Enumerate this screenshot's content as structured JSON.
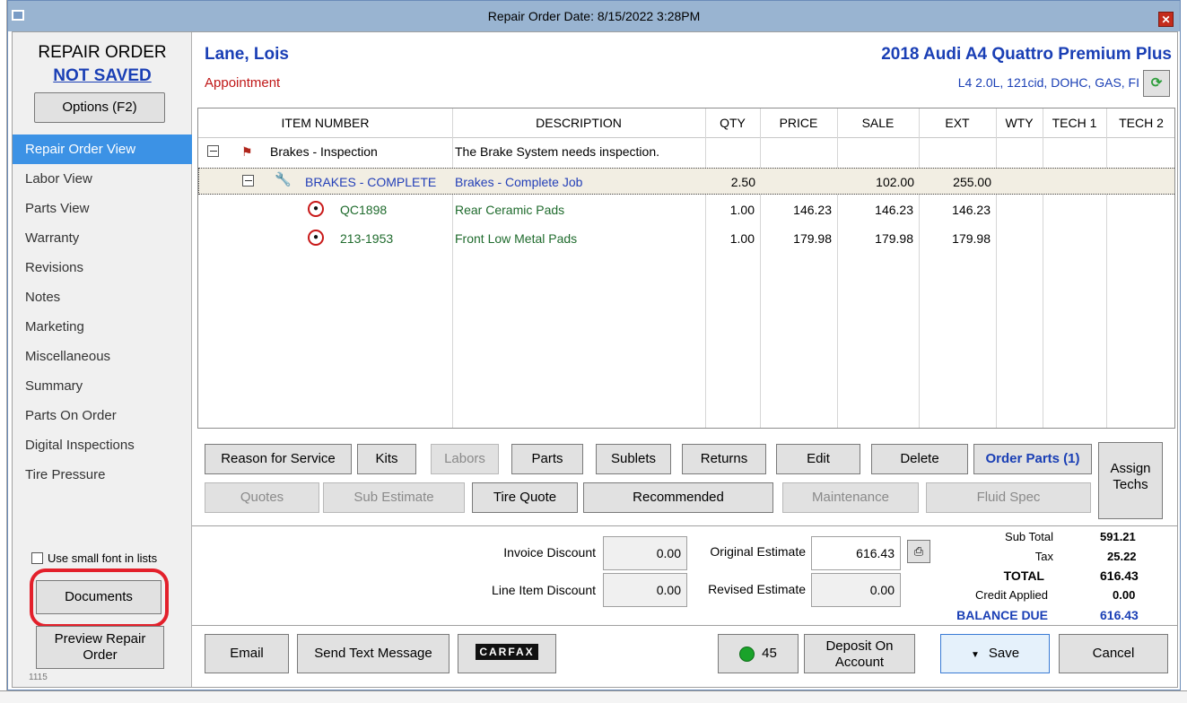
{
  "window": {
    "title": "Repair Order Date: 8/15/2022  3:28PM"
  },
  "nav": {
    "header": "REPAIR ORDER",
    "status": "NOT SAVED",
    "options_label": "Options (F2)",
    "items": [
      "Repair Order View",
      "Labor View",
      "Parts View",
      "Warranty",
      "Revisions",
      "Notes",
      "Marketing",
      "Miscellaneous",
      "Summary",
      "Parts On Order",
      "Digital Inspections",
      "Tire Pressure"
    ],
    "selected": "Repair Order View",
    "small_font_label": "Use small font in lists",
    "documents_label": "Documents",
    "preview_label_1": "Preview Repair",
    "preview_label_2": "Order",
    "footer_code": "1115"
  },
  "customer": {
    "name": "Lane, Lois",
    "type": "Appointment",
    "vehicle": "2018 Audi  A4 Quattro Premium Plus",
    "engine": "L4 2.0L, 121cid, DOHC, GAS, FI"
  },
  "grid": {
    "headers": [
      "ITEM NUMBER",
      "DESCRIPTION",
      "QTY",
      "PRICE",
      "SALE",
      "EXT",
      "WTY",
      "TECH 1",
      "TECH 2"
    ],
    "rows": [
      {
        "item": "Brakes - Inspection",
        "desc": "The Brake System needs inspection.",
        "qty": "",
        "price": "",
        "sale": "",
        "ext": ""
      },
      {
        "item": "BRAKES - COMPLETE",
        "desc": "Brakes - Complete Job",
        "qty": "2.50",
        "price": "",
        "sale": "102.00",
        "ext": "255.00"
      },
      {
        "item": "QC1898",
        "desc": "Rear Ceramic Pads",
        "qty": "1.00",
        "price": "146.23",
        "sale": "146.23",
        "ext": "146.23"
      },
      {
        "item": "213-1953",
        "desc": "Front Low Metal Pads",
        "qty": "1.00",
        "price": "179.98",
        "sale": "179.98",
        "ext": "179.98"
      }
    ]
  },
  "toolbar1": {
    "reason": "Reason for Service",
    "kits": "Kits",
    "labors": "Labors",
    "parts": "Parts",
    "sublets": "Sublets",
    "returns": "Returns",
    "edit": "Edit",
    "delete": "Delete",
    "order_parts": "Order Parts (1)",
    "assign_1": "Assign",
    "assign_2": "Techs"
  },
  "toolbar2": {
    "quotes": "Quotes",
    "sub_estimate": "Sub Estimate",
    "tire_quote": "Tire Quote",
    "recommended": "Recommended",
    "maintenance": "Maintenance",
    "fluid_spec": "Fluid Spec"
  },
  "totals": {
    "invoice_discount_label": "Invoice Discount",
    "invoice_discount": "0.00",
    "line_item_discount_label": "Line Item Discount",
    "line_item_discount": "0.00",
    "original_estimate_label": "Original Estimate",
    "original_estimate": "616.43",
    "revised_estimate_label": "Revised Estimate",
    "revised_estimate": "0.00",
    "sub_total_label": "Sub Total",
    "sub_total": "591.21",
    "tax_label": "Tax",
    "tax": "25.22",
    "total_label": "TOTAL",
    "total": "616.43",
    "credit_label": "Credit Applied",
    "credit": "0.00",
    "balance_label": "BALANCE DUE",
    "balance": "616.43"
  },
  "bottom": {
    "email": "Email",
    "send_text": "Send Text Message",
    "carfax": "CARFAX",
    "indicator_count": "45",
    "deposit_1": "Deposit On",
    "deposit_2": "Account",
    "save": "Save",
    "cancel": "Cancel"
  },
  "colors": {
    "accent": "#3c92e5",
    "titlebar": "#99b4d1",
    "highlight": "#e3202b",
    "link_blue": "#1a3fb5"
  }
}
